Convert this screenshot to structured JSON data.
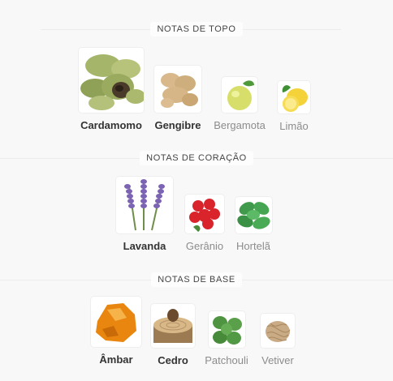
{
  "sections": [
    {
      "title": "NOTAS DE TOPO",
      "notes": [
        {
          "name": "Cardamomo",
          "icon": "cardamom-icon"
        },
        {
          "name": "Gengibre",
          "icon": "ginger-icon"
        },
        {
          "name": "Bergamota",
          "icon": "bergamot-icon"
        },
        {
          "name": "Limão",
          "icon": "lemon-icon"
        }
      ]
    },
    {
      "title": "NOTAS DE CORAÇÃO",
      "notes": [
        {
          "name": "Lavanda",
          "icon": "lavender-icon"
        },
        {
          "name": "Gerânio",
          "icon": "geranium-icon"
        },
        {
          "name": "Hortelã",
          "icon": "mint-icon"
        }
      ]
    },
    {
      "title": "NOTAS DE BASE",
      "notes": [
        {
          "name": "Âmbar",
          "icon": "amber-icon"
        },
        {
          "name": "Cedro",
          "icon": "cedar-icon"
        },
        {
          "name": "Patchouli",
          "icon": "patchouli-icon"
        },
        {
          "name": "Vetiver",
          "icon": "vetiver-icon"
        }
      ]
    }
  ]
}
